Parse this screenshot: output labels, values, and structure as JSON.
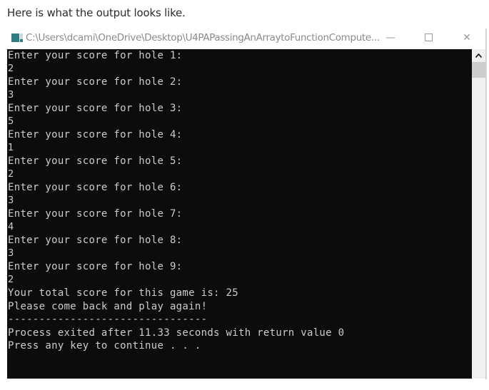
{
  "intro_text": "Here is what the output looks like.",
  "window": {
    "title": "C:\\Users\\dcami\\OneDrive\\Desktop\\U4PAPassingAnArraytoFunctionCompute...",
    "icon": "console-app-icon",
    "controls": {
      "minimize": "—",
      "maximize": "",
      "close": "✕"
    }
  },
  "console": {
    "lines": [
      {
        "text": "Enter your score for hole 1:",
        "type": "prompt"
      },
      {
        "text": "2",
        "type": "num"
      },
      {
        "text": "Enter your score for hole 2:",
        "type": "prompt"
      },
      {
        "text": "3",
        "type": "num"
      },
      {
        "text": "Enter your score for hole 3:",
        "type": "prompt"
      },
      {
        "text": "5",
        "type": "num"
      },
      {
        "text": "Enter your score for hole 4:",
        "type": "prompt"
      },
      {
        "text": "1",
        "type": "num"
      },
      {
        "text": "Enter your score for hole 5:",
        "type": "prompt"
      },
      {
        "text": "2",
        "type": "num"
      },
      {
        "text": "Enter your score for hole 6:",
        "type": "prompt"
      },
      {
        "text": "3",
        "type": "num"
      },
      {
        "text": "Enter your score for hole 7:",
        "type": "prompt"
      },
      {
        "text": "4",
        "type": "num"
      },
      {
        "text": "Enter your score for hole 8:",
        "type": "prompt"
      },
      {
        "text": "3",
        "type": "num"
      },
      {
        "text": "Enter your score for hole 9:",
        "type": "prompt"
      },
      {
        "text": "2",
        "type": "num"
      },
      {
        "text": "Your total score for this game is: 25",
        "type": "prompt"
      },
      {
        "text": "Please come back and play again!",
        "type": "prompt"
      },
      {
        "text": "--------------------------------",
        "type": "prompt"
      },
      {
        "text": "Process exited after 11.33 seconds with return value 0",
        "type": "prompt"
      },
      {
        "text": "Press any key to continue . . .",
        "type": "prompt"
      }
    ]
  },
  "colors": {
    "console_bg": "#0c0c0c",
    "console_fg": "#cccccc"
  }
}
